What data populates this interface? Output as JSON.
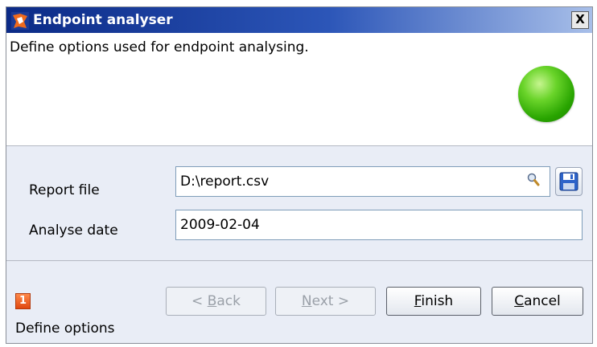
{
  "window": {
    "title": "Endpoint analyser",
    "close_label": "X"
  },
  "header": {
    "description": "Define options used for endpoint analysing.",
    "status_color": "#33b200"
  },
  "form": {
    "report_file": {
      "label": "Report file",
      "value": "D:\\report.csv"
    },
    "analyse_date": {
      "label": "Analyse date",
      "value": "2009-02-04"
    }
  },
  "footer": {
    "step_number": "1",
    "step_label": "Define options",
    "buttons": {
      "back": {
        "prefix": "< ",
        "mnemonic": "B",
        "rest": "ack",
        "enabled": false
      },
      "next": {
        "mnemonic": "N",
        "rest": "ext >",
        "enabled": false
      },
      "finish": {
        "mnemonic": "F",
        "rest": "inish",
        "enabled": true
      },
      "cancel": {
        "mnemonic": "C",
        "rest": "ancel",
        "enabled": true
      }
    }
  }
}
